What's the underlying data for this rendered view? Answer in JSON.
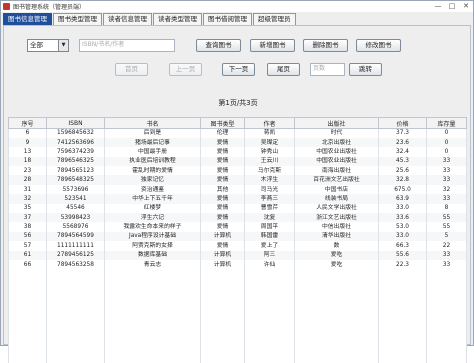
{
  "window": {
    "title": "图书管理系统（管理员端）",
    "controls": [
      "—",
      "□",
      "✕"
    ]
  },
  "tabs": [
    {
      "label": "图书信息管理",
      "active": true
    },
    {
      "label": "图书类型管理",
      "active": false
    },
    {
      "label": "读者信息管理",
      "active": false
    },
    {
      "label": "读者类型管理",
      "active": false
    },
    {
      "label": "图书借阅管理",
      "active": false
    },
    {
      "label": "超级管理员",
      "active": false
    }
  ],
  "search": {
    "filter_value": "全部",
    "isbn_placeholder": "ISBN/书名/作者"
  },
  "actions": {
    "query": "查询图书",
    "add": "新增图书",
    "delete": "删除图书",
    "modify": "修改图书"
  },
  "pager": {
    "first": "首页",
    "prev": "上一页",
    "next": "下一页",
    "last": "尾页",
    "page_placeholder": "页数",
    "jump": "跳转",
    "info": "第1页/共3页"
  },
  "table": {
    "columns": [
      "序号",
      "ISBN",
      "书名",
      "图书类型",
      "作者",
      "出版社",
      "价格",
      "库存量"
    ],
    "rows": [
      [
        "6",
        "1596845632",
        "后到是",
        "伦理",
        "蒋凯",
        "时代",
        "37.3",
        "0"
      ],
      [
        "9",
        "7412563696",
        "猪场最后记事",
        "爱情",
        "吴璨定",
        "北京出版社",
        "23.6",
        "0"
      ],
      [
        "13",
        "7596374239",
        "中国最手册",
        "爱情",
        "钟秀山",
        "中国农业出版社",
        "32.4",
        "0"
      ],
      [
        "18",
        "7896546325",
        "执业医后培训教程",
        "爱情",
        "王云川",
        "中国农业出版社",
        "45.3",
        "33"
      ],
      [
        "23",
        "7894565123",
        "霍乱时期的爱情",
        "爱情",
        "马尔克斯",
        "南海出版社",
        "25.6",
        "33"
      ],
      [
        "28",
        "7896548325",
        "独家记忆",
        "爱情",
        "木浮生",
        "百花洲文艺出版社",
        "32.8",
        "33"
      ],
      [
        "31",
        "5573696",
        "资治通鉴",
        "其他",
        "司马光",
        "中国书店",
        "675.0",
        "32"
      ],
      [
        "32",
        "523541",
        "中华上下五千年",
        "爱情",
        "李燕三",
        "线装书局",
        "63.9",
        "33"
      ],
      [
        "35",
        "45546",
        "红楼梦",
        "爱情",
        "曹雪芹",
        "人民文学出版社",
        "33.0",
        "8"
      ],
      [
        "37",
        "53998423",
        "浮生六记",
        "爱情",
        "沈复",
        "浙江文艺出版社",
        "33.6",
        "55"
      ],
      [
        "38",
        "5568976",
        "我露欢生命本来的样子",
        "爱情",
        "周国平",
        "中信出版社",
        "53.0",
        "55"
      ],
      [
        "56",
        "7894564599",
        "Java程序设计基础",
        "计算机",
        "韩国雷",
        "清华出版社",
        "33.0",
        "5"
      ],
      [
        "57",
        "1111111111",
        "阿贾克斯的女择",
        "爱情",
        "爱上了",
        "数",
        "66.3",
        "22"
      ],
      [
        "61",
        "2789456125",
        "数据库基础",
        "计算机",
        "阿三",
        "爱吃",
        "55.6",
        "33"
      ],
      [
        "66",
        "7894563258",
        "青云志",
        "计算机",
        "许仙",
        "爱吃",
        "22.3",
        "33"
      ]
    ]
  }
}
